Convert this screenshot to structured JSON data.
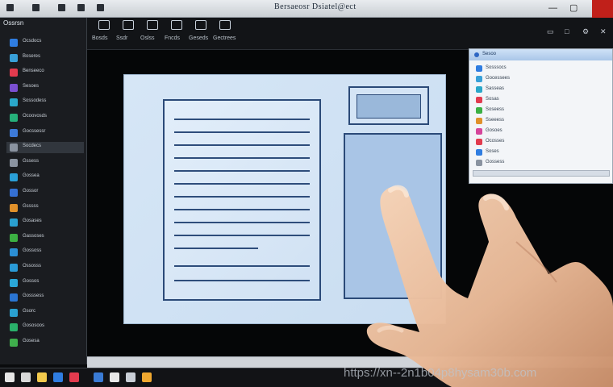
{
  "window": {
    "title": "Bersaeosr Dsiatel@ect"
  },
  "toolbar": {
    "tools": [
      {
        "label": "Bosds",
        "icon": "folder-icon"
      },
      {
        "label": "Ssdr",
        "icon": "edit-icon"
      },
      {
        "label": "Oslss",
        "icon": "layers-icon"
      },
      {
        "label": "Fncds",
        "icon": "grid-icon"
      },
      {
        "label": "Geseds",
        "icon": "view-icon"
      },
      {
        "label": "Gectrees",
        "icon": "panel-icon"
      }
    ]
  },
  "sidebar": {
    "header": "Ossrsn",
    "items": [
      {
        "label": "Ocsdocs",
        "color": "#2f7de1"
      },
      {
        "label": "Boseres",
        "color": "#38a0d8"
      },
      {
        "label": "Benseeco",
        "color": "#e23b4e"
      },
      {
        "label": "Sesoes",
        "color": "#7a4fd0"
      },
      {
        "label": "Sossodess",
        "color": "#2aa7c9"
      },
      {
        "label": "Ocoovosds",
        "color": "#26b07a"
      },
      {
        "label": "Gocssessr",
        "color": "#3d7ad8"
      },
      {
        "label": "Socdecs",
        "color": "#8a93a0"
      },
      {
        "label": "Gssess",
        "color": "#8a93a0"
      },
      {
        "label": "Gossea",
        "color": "#2a9fd6"
      },
      {
        "label": "Gossor",
        "color": "#3570d2"
      },
      {
        "label": "Gsssss",
        "color": "#e0902a"
      },
      {
        "label": "Gosases",
        "color": "#2aa0d0"
      },
      {
        "label": "Gassoses",
        "color": "#3cb043"
      },
      {
        "label": "Gossoss",
        "color": "#2b8fd4"
      },
      {
        "label": "Ossosss",
        "color": "#2a9ad6"
      },
      {
        "label": "Gossos",
        "color": "#2aa7d8"
      },
      {
        "label": "Gosssess",
        "color": "#2a74d2"
      },
      {
        "label": "Gsorc",
        "color": "#2aa0d0"
      },
      {
        "label": "Gososoos",
        "color": "#2ab06a"
      },
      {
        "label": "Gosesa",
        "color": "#3fae4c"
      }
    ]
  },
  "panel": {
    "title": "Sesoo",
    "rows": [
      {
        "label": "Sosssocs",
        "color": "#2f7de1"
      },
      {
        "label": "Gocessees",
        "color": "#38a0d8"
      },
      {
        "label": "Sasseas",
        "color": "#2aa7c9"
      },
      {
        "label": "Sosas",
        "color": "#e23b4e"
      },
      {
        "label": "Soseess",
        "color": "#3cb043"
      },
      {
        "label": "Sseeess",
        "color": "#e0902a"
      },
      {
        "label": "Gosoes",
        "color": "#d6469b"
      },
      {
        "label": "Ocosses",
        "color": "#e23b4e"
      },
      {
        "label": "Soses",
        "color": "#2f7de1"
      },
      {
        "label": "Gossess",
        "color": "#8a93a0"
      }
    ]
  },
  "watermark": "https://xn--2n1b04p8hysam30b.com"
}
